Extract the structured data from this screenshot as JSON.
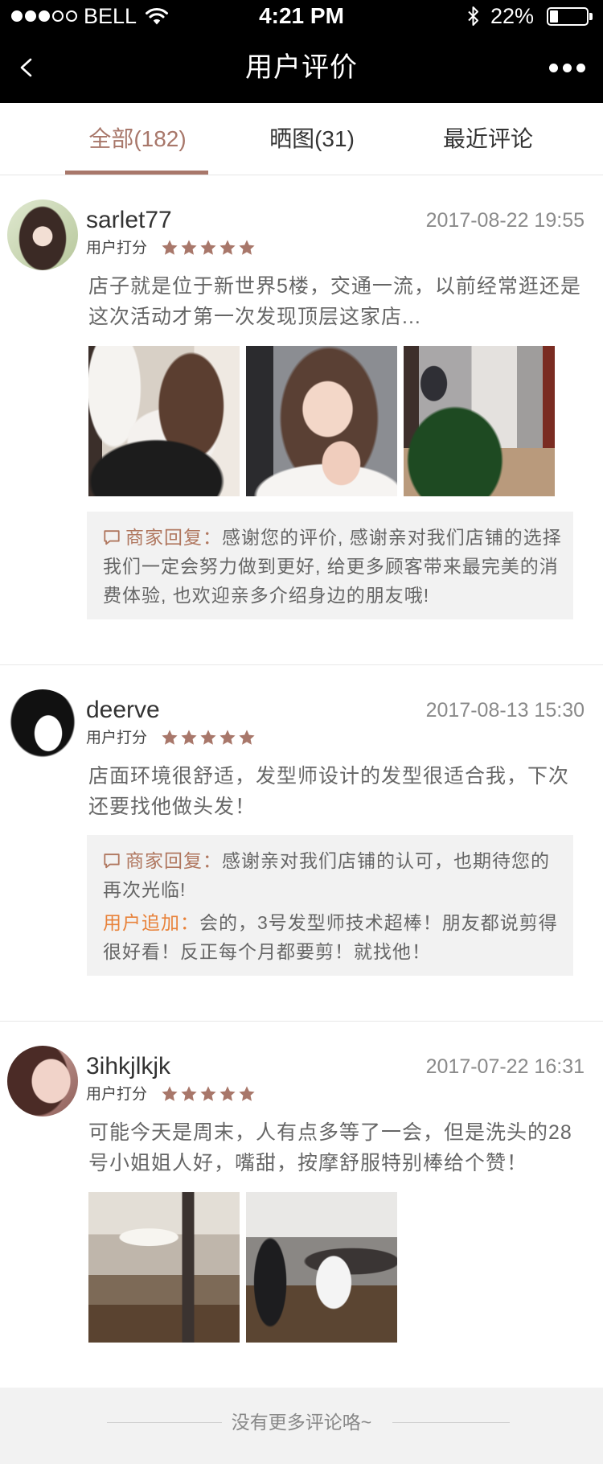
{
  "status_bar": {
    "signal_level": 3,
    "signal_max": 5,
    "carrier": "BELL",
    "wifi_icon": "wifi-icon",
    "time": "4:21 PM",
    "bluetooth_icon": "bluetooth-icon",
    "battery_text": "22%",
    "battery_level": 0.22
  },
  "nav": {
    "back_icon": "chevron-left-icon",
    "title": "用户评价",
    "more_icon": "more-dots-icon"
  },
  "tabs": [
    {
      "label": "全部(182)",
      "active": true
    },
    {
      "label": "晒图(31)",
      "active": false
    },
    {
      "label": "最近评论",
      "active": false
    }
  ],
  "colors": {
    "accent": "#a8776a",
    "reply_label": "#b0775f",
    "append_label": "#e8823a",
    "nav_background": "#000000",
    "reply_background": "#f2f2f2"
  },
  "reviews": [
    {
      "username": "sarlet77",
      "date": "2017-08-22 19:55",
      "rating_label": "用户打分",
      "rating": 5,
      "content_lines": [
        "店子就是位于新世界5楼，交通一流，以前经常逛还是",
        "这次活动才第一次发现顶层这家店..."
      ],
      "replies": [
        {
          "icon": "chat-bubble-icon",
          "label": "商家回复：",
          "lines": [
            "感谢您的评价, 感谢亲对我们店铺的选择",
            "我们一定会努力做到更好, 给更多顾客带来最完美的消",
            "费体验, 也欢迎亲多介绍身边的朋友哦!"
          ]
        }
      ]
    },
    {
      "username": "deerve",
      "date": "2017-08-13 15:30",
      "rating_label": "用户打分",
      "rating": 5,
      "content_lines": [
        "店面环境很舒适，发型师设计的发型很适合我，下次",
        "还要找他做头发！"
      ],
      "replies": [
        {
          "icon": "chat-bubble-icon",
          "label": "商家回复：",
          "lines": [
            "感谢亲对我们店铺的认可，也期待您的",
            "再次光临!"
          ]
        },
        {
          "label": "用户追加：",
          "lines": [
            "会的，3号发型师技术超棒！朋友都说剪得",
            "很好看！反正每个月都要剪！就找他！"
          ]
        }
      ]
    },
    {
      "username": "3ihkjlkjk",
      "date": "2017-07-22 16:31",
      "rating_label": "用户打分",
      "rating": 5,
      "content_lines": [
        "可能今天是周末，人有点多等了一会，但是洗头的28",
        "号小姐姐人好，嘴甜，按摩舒服特别棒给个赞！"
      ],
      "replies": []
    }
  ],
  "footer": {
    "end_text": "没有更多评论咯~"
  }
}
